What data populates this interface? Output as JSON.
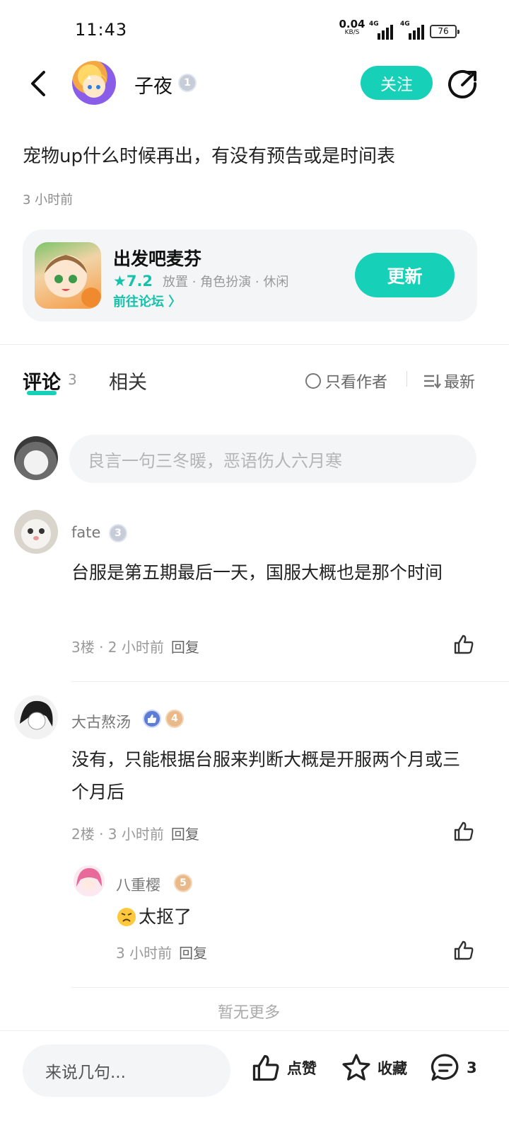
{
  "status_bar": {
    "time": "11:43",
    "net_speed": "0.04",
    "net_unit": "KB/S",
    "signal1": "4G",
    "signal2": "4G",
    "battery": "76"
  },
  "header": {
    "author_name": "子夜",
    "author_level": "1",
    "follow_label": "关注"
  },
  "post": {
    "title": "宠物up什么时候再出，有没有预告或是时间表",
    "time": "3 小时前"
  },
  "game": {
    "name": "出发吧麦芬",
    "score": "7.2",
    "tags": "放置 · 角色扮演 · 休闲",
    "forum_link": "前往论坛 〉",
    "update_label": "更新"
  },
  "tabs": {
    "comments_label": "评论",
    "comments_count": "3",
    "related_label": "相关",
    "only_author_label": "只看作者",
    "sort_label": "最新"
  },
  "comment_input": {
    "placeholder": "良言一句三冬暖，恶语伤人六月寒"
  },
  "comments": [
    {
      "user": "fate",
      "level": "3",
      "text": "台服是第五期最后一天，国服大概也是那个时间",
      "floor_time": "3楼 · 2 小时前",
      "reply_label": "回复"
    },
    {
      "user": "大古熬汤",
      "level": "4",
      "text": "没有，只能根据台服来判断大概是开服两个月或三个月后",
      "floor_time": "2楼 · 3 小时前",
      "reply_label": "回复",
      "replies": [
        {
          "user": "八重樱",
          "level": "5",
          "text": "太抠了",
          "time": "3 小时前",
          "reply_label": "回复"
        }
      ]
    }
  ],
  "no_more": "暂无更多",
  "bottom_bar": {
    "input_placeholder": "来说几句...",
    "like_label": "点赞",
    "favorite_label": "收藏",
    "comment_count": "3"
  },
  "colors": {
    "accent": "#16d1b7",
    "accent_text": "#16c2ab"
  }
}
